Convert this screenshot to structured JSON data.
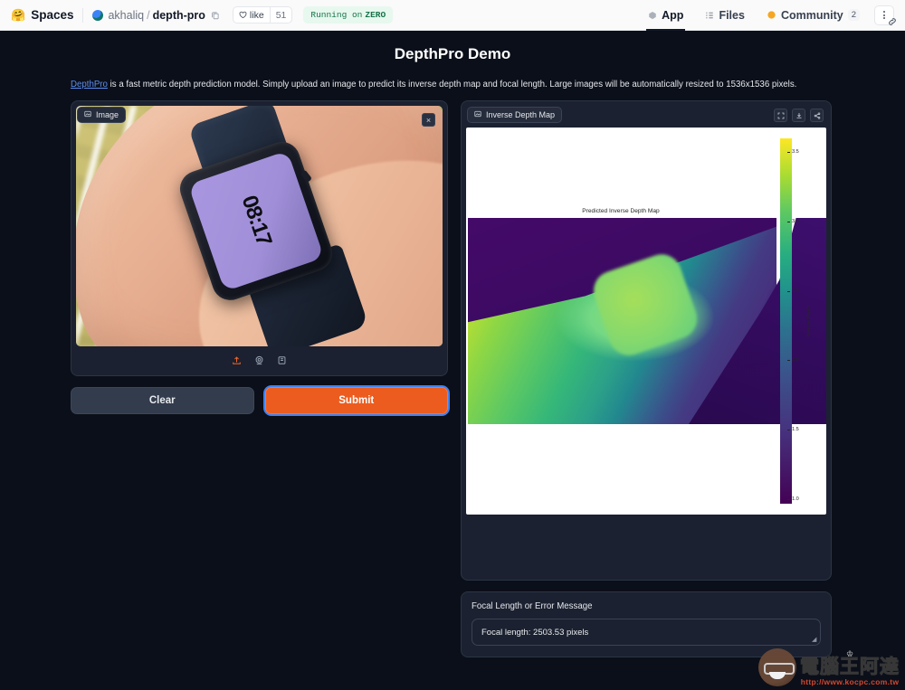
{
  "header": {
    "spaces_emoji": "🤗",
    "spaces_label": "Spaces",
    "owner": "akhaliq",
    "path_sep": "/",
    "repo": "depth-pro",
    "copy_icon": "copy-icon",
    "like_label": "like",
    "like_count": "51",
    "running_prefix": "Running on",
    "running_hardware": "ZERO",
    "nav": [
      {
        "label": "App",
        "icon": "cube-icon",
        "active": true,
        "badge": ""
      },
      {
        "label": "Files",
        "icon": "files-icon",
        "active": false,
        "badge": ""
      },
      {
        "label": "Community",
        "icon": "community-icon",
        "active": false,
        "badge": "2"
      }
    ],
    "kebab_icon": "three-dots-vertical-icon",
    "cursor_icon": "link-cursor-icon"
  },
  "main": {
    "title": "DepthPro Demo",
    "description_link": "DepthPro",
    "description_rest": " is a fast metric depth prediction model. Simply upload an image to predict its inverse depth map and focal length. Large images will be automatically resized to 1536x1536 pixels."
  },
  "image_panel": {
    "label": "Image",
    "label_icon": "image-icon",
    "close_icon": "×",
    "photo_alt": "smartwatch-on-wrist",
    "watch_time": "08:17",
    "toolbar": [
      {
        "name": "upload-icon",
        "glyph": "⬆"
      },
      {
        "name": "webcam-icon",
        "glyph": "◎"
      },
      {
        "name": "paste-clipboard-icon",
        "glyph": "⎘"
      }
    ],
    "clear_label": "Clear",
    "submit_label": "Submit"
  },
  "depth_panel": {
    "label": "Inverse Depth Map",
    "label_icon": "image-icon",
    "icons": [
      {
        "name": "fullscreen-icon",
        "glyph": "⛶"
      },
      {
        "name": "download-icon",
        "glyph": "⤓"
      },
      {
        "name": "share-icon",
        "glyph": "⋖"
      }
    ]
  },
  "focal_panel": {
    "label": "Focal Length or Error Message",
    "value": "Focal length: 2503.53 pixels",
    "placeholder": ""
  },
  "watermark": {
    "crown": "♔",
    "cn_text": "電腦王阿達",
    "url": "http://www.kocpc.com.tw"
  },
  "colors": {
    "accent_orange": "#ec5c1e",
    "focus_blue": "#3b82f6",
    "page_bg": "#0b0f19",
    "panel_bg": "#1b2130",
    "running_green": "#157347",
    "link_blue": "#5b8def"
  },
  "chart_data": {
    "type": "heatmap",
    "title": "Predicted Inverse Depth Map",
    "xlabel": "",
    "ylabel": "",
    "colorbar_label": "Inverse Depth",
    "colormap": "viridis",
    "ticks": [
      "3.5",
      "3.0",
      "2.5",
      "2.0",
      "1.5",
      "1.0"
    ],
    "tick_positions_pct": [
      3,
      22,
      41,
      60,
      79,
      98
    ],
    "zlim": [
      0.8,
      3.6
    ],
    "grid": false,
    "legend": "colorbar-right"
  }
}
